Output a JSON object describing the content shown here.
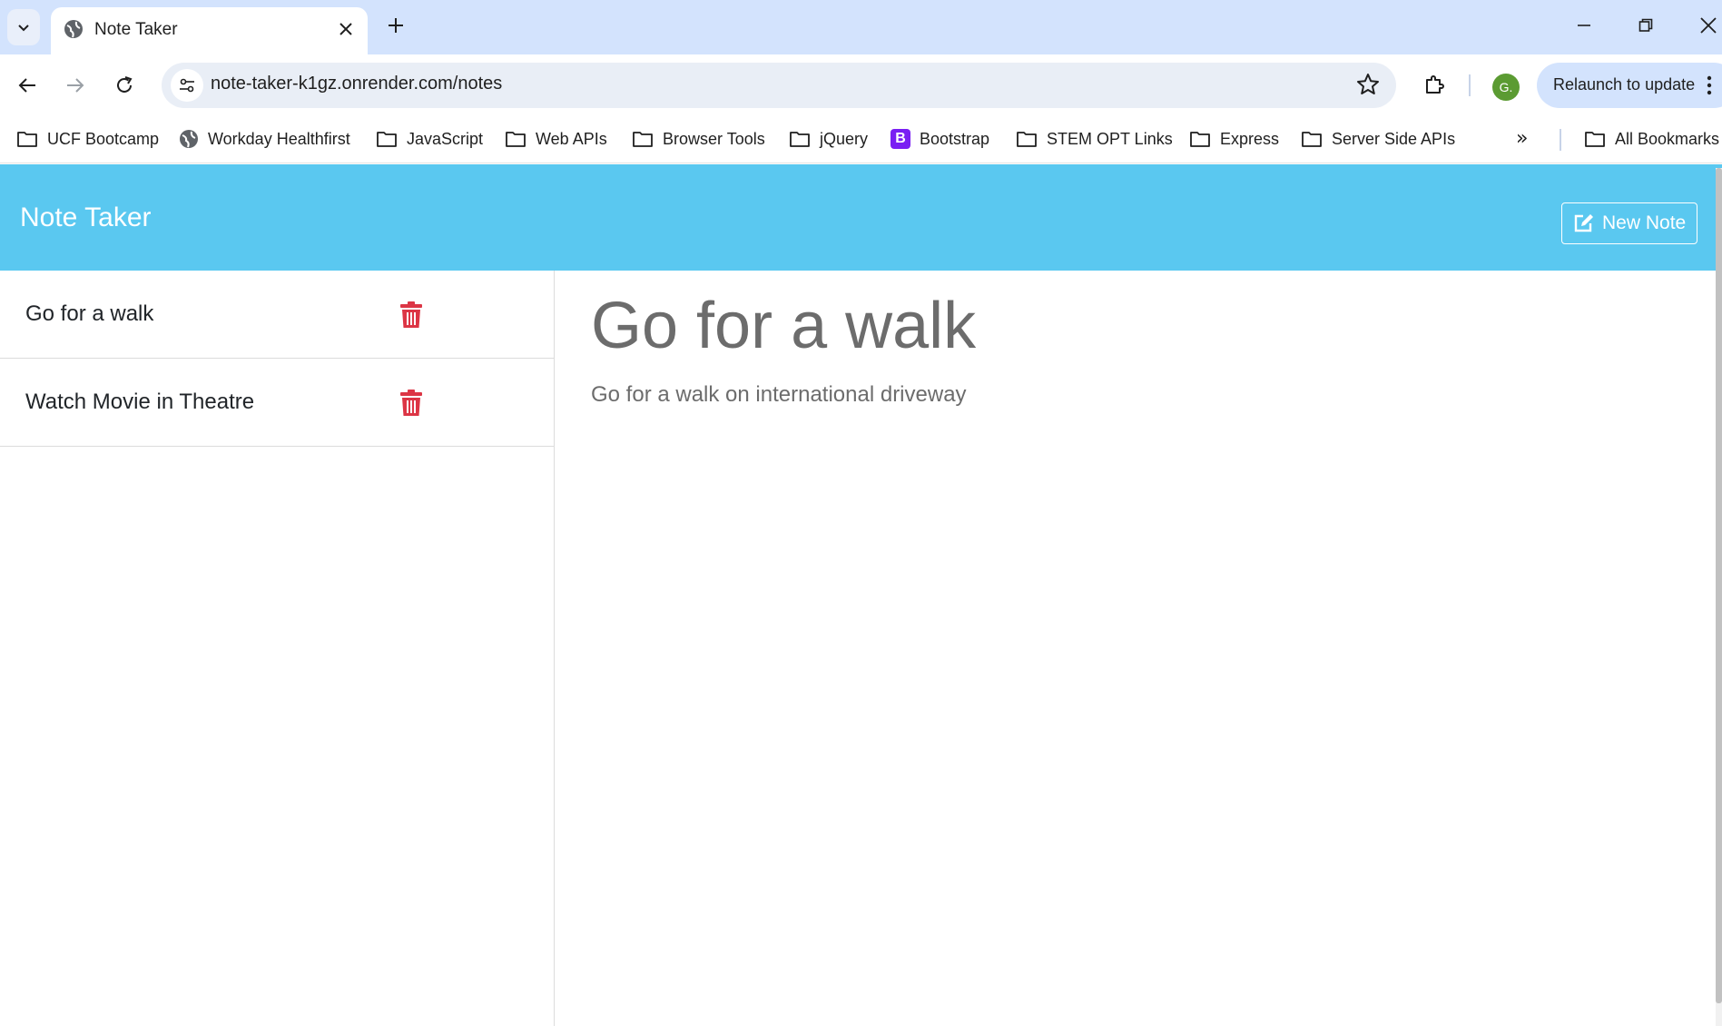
{
  "browser": {
    "tab": {
      "title": "Note Taker",
      "favicon": "globe-icon"
    },
    "url": "note-taker-k1gz.onrender.com/notes",
    "profile_initial": "G.",
    "relaunch_label": "Relaunch to update",
    "bookmarks": [
      {
        "label": "UCF Bootcamp",
        "icon": "folder-icon"
      },
      {
        "label": "Workday Healthfirst",
        "icon": "globe-icon"
      },
      {
        "label": "JavaScript",
        "icon": "folder-icon"
      },
      {
        "label": "Web APIs",
        "icon": "folder-icon"
      },
      {
        "label": "Browser Tools",
        "icon": "folder-icon"
      },
      {
        "label": "jQuery",
        "icon": "folder-icon"
      },
      {
        "label": "Bootstrap",
        "icon": "bootstrap-icon"
      },
      {
        "label": "STEM OPT Links",
        "icon": "folder-icon"
      },
      {
        "label": "Express",
        "icon": "folder-icon"
      },
      {
        "label": "Server Side APIs",
        "icon": "folder-icon"
      }
    ],
    "bookmarks_more": "»",
    "all_bookmarks": "All Bookmarks"
  },
  "app": {
    "brand": "Note Taker",
    "new_note_label": "New Note",
    "notes": [
      {
        "title": "Go for a walk"
      },
      {
        "title": "Watch Movie in Theatre"
      }
    ],
    "active_note": {
      "title": "Go for a walk",
      "text": "Go for a walk on international driveway"
    }
  },
  "colors": {
    "navbar": "#5ac8f0",
    "delete": "#dc3545",
    "muted_text": "#6c6c6c"
  }
}
